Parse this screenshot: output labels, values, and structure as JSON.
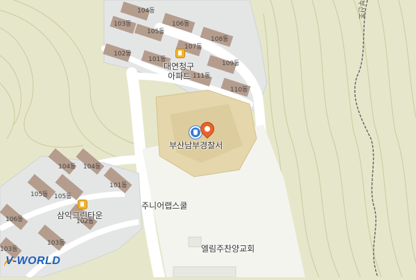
{
  "map": {
    "colors": {
      "terrain": "#e6e7ca",
      "contour": "#c9c7a0",
      "complex": "#e4e6e6",
      "building": "#b59d8e",
      "road": "#ffffff",
      "school": "#e5d6ab",
      "trail": "#666666"
    },
    "labels": {
      "upper_buildings": [
        "104동",
        "103동",
        "106동",
        "105동",
        "108동",
        "107동",
        "102동",
        "101동",
        "111동",
        "109동",
        "110동"
      ],
      "upper_complex": "대연청구\n아파트",
      "upper_complex_line1": "대연청구",
      "upper_complex_line2": "아파트",
      "police": "부산남부경찰서",
      "school": "주니어랩스쿨",
      "church": "엘림주찬양교회",
      "lower_buildings": [
        "104동",
        "104동",
        "105동",
        "101동",
        "106동",
        "105동",
        "102동",
        "103동",
        "103동"
      ],
      "lower_complex": "삼익그린타운",
      "trail": "부산초"
    },
    "icons": [
      "apartment-icon",
      "police-icon",
      "location-marker-icon",
      "apartment-icon"
    ],
    "logo": {
      "v": "V",
      "rest": "-WORLD"
    }
  }
}
